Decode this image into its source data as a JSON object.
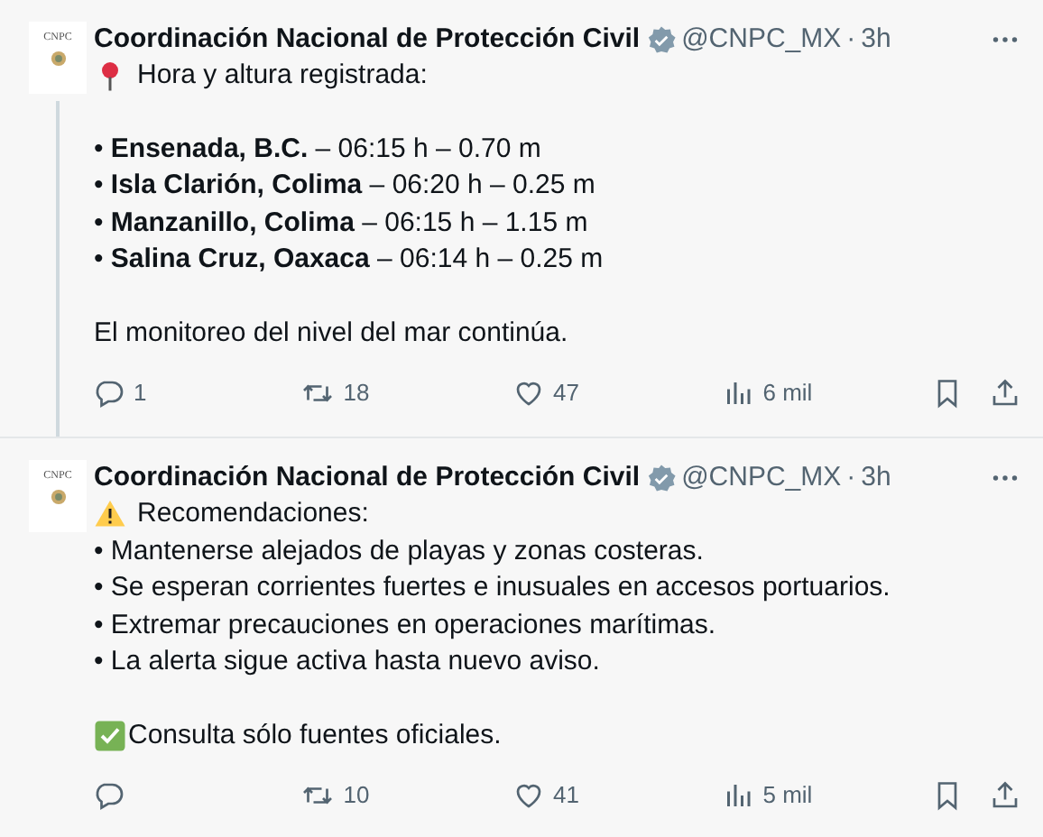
{
  "tweets": [
    {
      "avatar_text": "CNPC",
      "name": "Coordinación Nacional de Protección Civil",
      "verified": true,
      "handle": "@CNPC_MX",
      "separator": "·",
      "time": "3h",
      "thread_continues": true,
      "lines": [
        {
          "kind": "pin",
          "text": "Hora y altura registrada:"
        },
        {
          "kind": "text",
          "space_before": true,
          "text": "• **Ensenada, B.C.** – 06:15 h – 0.70 m"
        },
        {
          "kind": "text",
          "text": "• **Isla Clarión, Colima** – 06:20 h – 0.25 m"
        },
        {
          "kind": "text",
          "text": "• **Manzanillo, Colima** – 06:15 h – 1.15 m"
        },
        {
          "kind": "text",
          "text": "• **Salina Cruz, Oaxaca** – 06:14 h – 0.25 m"
        },
        {
          "kind": "text",
          "space_before": true,
          "text": "El monitoreo del nivel del mar continúa."
        }
      ],
      "stats": [
        {
          "kind": "reply",
          "count": "1"
        },
        {
          "kind": "repost",
          "count": "18"
        },
        {
          "kind": "like",
          "count": "47"
        },
        {
          "kind": "views",
          "count": "6 mil"
        }
      ]
    },
    {
      "avatar_text": "CNPC",
      "name": "Coordinación Nacional de Protección Civil",
      "verified": true,
      "handle": "@CNPC_MX",
      "separator": "·",
      "time": "3h",
      "thread_continues": false,
      "lines": [
        {
          "kind": "warning",
          "text": "Recomendaciones:"
        },
        {
          "kind": "text",
          "text": "• Mantenerse alejados de playas y zonas costeras."
        },
        {
          "kind": "text",
          "text": "• Se esperan corrientes fuertes e inusuales en accesos portuarios."
        },
        {
          "kind": "text",
          "text": "• Extremar precauciones en operaciones marítimas."
        },
        {
          "kind": "text",
          "text": "• La alerta sigue activa hasta nuevo aviso."
        },
        {
          "kind": "check",
          "space_before": true,
          "text": "Consulta sólo fuentes oficiales."
        }
      ],
      "stats": [
        {
          "kind": "reply"
        },
        {
          "kind": "repost",
          "count": "10"
        },
        {
          "kind": "like",
          "count": "41"
        },
        {
          "kind": "views",
          "count": "5 mil"
        }
      ]
    }
  ]
}
